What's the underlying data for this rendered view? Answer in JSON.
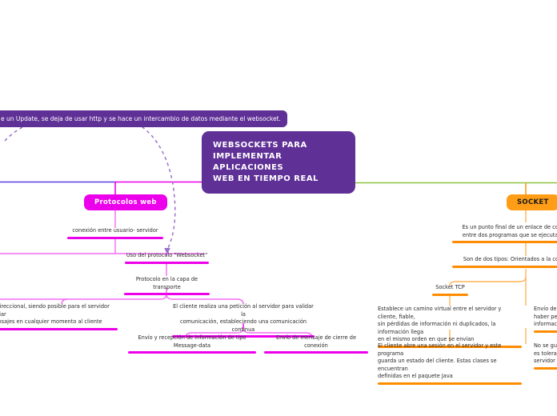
{
  "meta": {
    "kind": "mind-map",
    "background": "#ffffff",
    "colors": {
      "root_purple": "#5f3096",
      "magenta": "#ec00ec",
      "orange": "#ff8c00",
      "orange_node": "#ff9d17",
      "green_trunk": "#8cc63f",
      "blue_trunk": "#5b3ee8",
      "dashed_purple": "#9b6fc9",
      "leaf_text": "#2a2a2a"
    }
  },
  "root": {
    "label": "WEBSOCKETS PARA IMPLEMENTAR APLICACIONES WEB EN TIEMPO REAL",
    "line1": "WEBSOCKETS PARA",
    "line2": "IMPLEMENTAR APLICACIONES",
    "line3": "WEB EN TIEMPO REAL"
  },
  "callout": {
    "text": "e un Update, se deja de usar http y se hace un intercambio de datos mediante el websocket.",
    "note": "clipped at left edge of viewport"
  },
  "branches": {
    "protocolos_web": {
      "label": "Protocolos web",
      "color": "#ec00ec",
      "nodes": {
        "conexion": "conexión entre usuario- servidor",
        "uso_protocolo": "Uso del protocolo \"Websocket\"",
        "capa_transporte": "Protocolo en la capa de transporte",
        "bidireccional_l1": "bi-direccional, siendo posible para el servidor enviar",
        "bidireccional_l2": "mensajes en cualquier momento al cliente",
        "peticion_l1": "El cliente realiza una petición al servidor para validar la",
        "peticion_l2": "comunicación, estableciendo una comunicación continua",
        "envio_recepcion": "Envío y recepción de información de tipo Message-data",
        "cierre_conexion": "Envío de mensaje de cierre de conexión"
      }
    },
    "socket": {
      "label": "SOCKET",
      "color": "#ff9d17",
      "nodes": {
        "punto_final_l1": "Es un punto final de un enlace de comunicaci",
        "punto_final_l2": "entre dos programas que se ejecutan a travé",
        "dos_tipos": "Son de dos tipos: Orientados a la conexión y",
        "socket_tcp": "Socket TCP",
        "camino_virtual_l1": "Establece un camino virtual entre el servidor y cliente, fiable,",
        "camino_virtual_l2": "sin pérdidas de información ni duplicados, la información llega",
        "camino_virtual_l3": "en el mismo orden en que se envían",
        "sesion_l1": "El cliente abre una sesión en el servidor y este programa",
        "sesion_l2": "guarda un estado del cliente. Estas clases se encuentran",
        "sesion_l3": "definidas en el paquete Java",
        "envio_d_l1": "Envío de D",
        "envio_d_l2": "haber perd",
        "envio_d_l3": "informació",
        "no_guarda_l1": "No se guar",
        "no_guarda_l2": "es toleranb",
        "no_guarda_l3": "servidor uti"
      }
    }
  }
}
